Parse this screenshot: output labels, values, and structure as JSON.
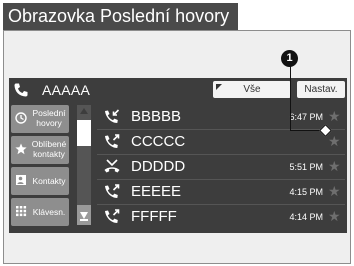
{
  "page_title": "Obrazovka Poslední hovory",
  "callout_number": "1",
  "header": {
    "contact_name": "AAAAA",
    "filter_all_label": "Vše",
    "settings_label": "Nastav."
  },
  "sidebar": {
    "items": [
      {
        "label": "Poslední hovory",
        "icon": "clock-icon"
      },
      {
        "label": "Oblíbené kontakty",
        "icon": "star-icon"
      },
      {
        "label": "Kontakty",
        "icon": "contact-card-icon"
      },
      {
        "label": "Klávesn.",
        "icon": "keypad-icon"
      }
    ]
  },
  "calls": [
    {
      "name": "BBBBB",
      "time": "6:47 PM",
      "type": "incoming"
    },
    {
      "name": "CCCCC",
      "time": "",
      "type": "outgoing"
    },
    {
      "name": "DDDDD",
      "time": "5:51 PM",
      "type": "missed"
    },
    {
      "name": "EEEEE",
      "time": "4:15 PM",
      "type": "outgoing"
    },
    {
      "name": "FFFFF",
      "time": "4:14 PM",
      "type": "outgoing"
    }
  ],
  "colors": {
    "screen_bg": "#3d3d3d",
    "sidebar_button": "#8e8e8e",
    "title_bar": "#4a4a4a"
  }
}
